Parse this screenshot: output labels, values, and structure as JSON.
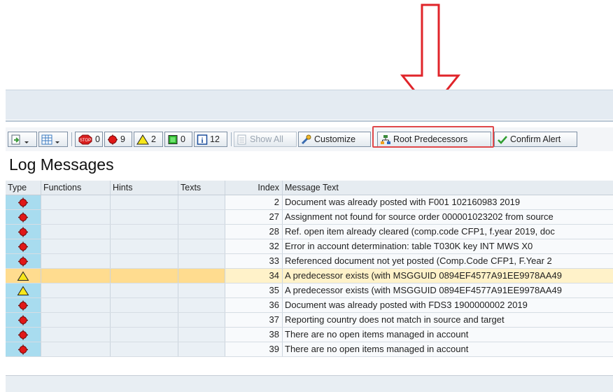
{
  "toolbar": {
    "count_stop": "0",
    "count_error": "9",
    "count_warning": "2",
    "count_success": "0",
    "count_info": "12",
    "show_all": "Show All",
    "customize": "Customize",
    "root_predecessors": "Root Predecessors",
    "confirm_alert": "Confirm Alert"
  },
  "title": "Log Messages",
  "columns": {
    "type": "Type",
    "functions": "Functions",
    "hints": "Hints",
    "texts": "Texts",
    "index": "Index",
    "message": "Message Text"
  },
  "rows": [
    {
      "type": "error",
      "index": "2",
      "message": "Document was already posted with F001 102160983 2019"
    },
    {
      "type": "error",
      "index": "27",
      "message": "Assignment not found for source order 000001023202 from source"
    },
    {
      "type": "error",
      "index": "28",
      "message": "Ref. open item already cleared (comp.code CFP1, f.year 2019, doc"
    },
    {
      "type": "error",
      "index": "32",
      "message": "Error in account determination: table T030K key INT MWS X0"
    },
    {
      "type": "error",
      "index": "33",
      "message": "Referenced document not yet posted (Comp.Code CFP1, F.Year 2"
    },
    {
      "type": "warning",
      "index": "34",
      "message": "A predecessor exists (with MSGGUID 0894EF4577A91EE9978AA49",
      "selected": true
    },
    {
      "type": "warning",
      "index": "35",
      "message": "A predecessor exists (with MSGGUID 0894EF4577A91EE9978AA49"
    },
    {
      "type": "error",
      "index": "36",
      "message": "Document was already posted with FDS3 1900000002 2019"
    },
    {
      "type": "error",
      "index": "37",
      "message": "Reporting country does not match in source and target"
    },
    {
      "type": "error",
      "index": "38",
      "message": "There are no open items managed in account"
    },
    {
      "type": "error",
      "index": "39",
      "message": "There are no open items managed in account"
    }
  ],
  "colors": {
    "highlight_box": "#e0484a",
    "annotation_arrow": "#e0242a",
    "selected_row": "#ffdc8f"
  }
}
